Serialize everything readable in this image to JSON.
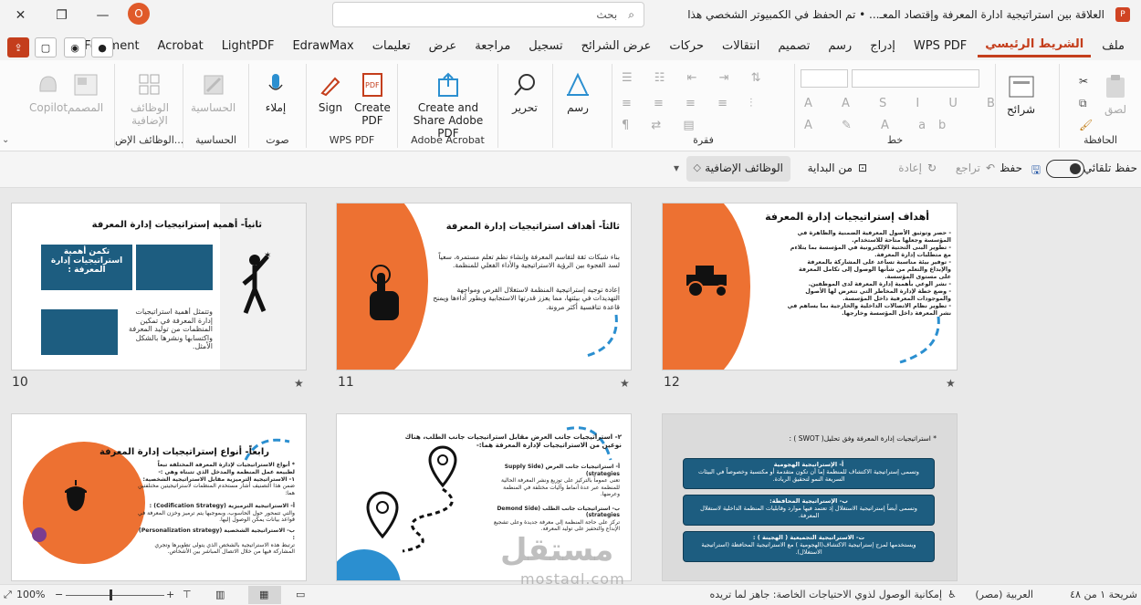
{
  "titlebar": {
    "doc_title": "العلاقة بين استراتيجية ادارة المعرفة وإقتصاد المعـ...  •  تم الحفظ في الكمبيوتر الشخصي هذا",
    "avatar_letter": "O",
    "search_placeholder": "بحث",
    "app_letter": "P"
  },
  "tabs": [
    "ملف",
    "الشريط الرئيسي",
    "WPS PDF",
    "إدراج",
    "رسم",
    "تصميم",
    "انتقالات",
    "حركات",
    "عرض الشرائح",
    "تسجيل",
    "مراجعة",
    "عرض",
    "تعليمات",
    "EdrawMax",
    "LightPDF",
    "Acrobat",
    "PDFelement"
  ],
  "active_tab": "الشريط الرئيسي",
  "ribbon": {
    "clipboard": {
      "label": "الحافظة",
      "paste": "لصق"
    },
    "slides": {
      "label": "شرائح"
    },
    "font": {
      "label": "خط"
    },
    "paragraph": {
      "label": "فقرة"
    },
    "draw": {
      "label": "رسم"
    },
    "edit": {
      "label": "تحرير"
    },
    "acrobat": {
      "label": "Adobe Acrobat",
      "btn": "Create and Share Adobe PDF"
    },
    "wps": {
      "label": "WPS PDF",
      "create": "Create PDF",
      "sign": "Sign"
    },
    "voice": {
      "label": "صوت",
      "dictate": "إملاء"
    },
    "sensitivity": {
      "label": "الحساسية",
      "btn": "الحساسية"
    },
    "addins": {
      "label": "الوظائف الإض...",
      "btn": "الوظائف الإضافية"
    },
    "designer": {
      "btn": "المصمم"
    },
    "copilot": {
      "btn": "Copilot"
    }
  },
  "bar2": {
    "autosave": "حفظ تلقائي",
    "save": "حفظ",
    "undo": "تراجع",
    "redo": "إعادة",
    "from_start": "من البداية",
    "addins": "الوظائف الإضافية"
  },
  "slides": [
    {
      "num": "10",
      "title": "ثانياً- أهمية إستراتيجيات إدارة المعرفة",
      "box_title": "تكمن أهمية استراتيجيات إدارة المعرفة :",
      "box_lower": "وتتمثل أهمية استراتيجيات إدارة المعرفة في تمكين المنظمات من توليد المعرفة واكتسابها ونشرها بالشكل الأمثل."
    },
    {
      "num": "11",
      "title": "ثالثاً- أهداف استراتيجيات إدارة المعرفة",
      "lines": [
        "بناء شبكات ثقة لتقاسم المعرفة وإنشاء نظم تعلم مستمرة، سعياً لسد الفجوة بين الرؤية الاستراتيجية والأداء الفعلي للمنظمة.",
        "إعادة توجيه إستراتيجية المنظمة لاستغلال الفرص ومواجهة التهديدات في بيئتها، مما يعزز قدرتها الاستجابية ويطور أداءها ويمنح قاعدة تنافسية أكثر مرونة."
      ]
    },
    {
      "num": "12",
      "title": "أهداف إستراتيجيات إدارة المعرفة",
      "lines": [
        "- حصر وتوثيق الأصول المعرفية الضمنية والظاهرة في المؤسسة وجعلها متاحة للاستخدام.",
        "- تطوير البنى التحتية الإلكترونية في المؤسسة بما يتلاءم مع متطلبات إدارة المعرفة.",
        "- توفير بيئة مناسبة تساعد على المشاركة بالمعرفة والإبداع والتعلم من شأنها الوصول إلى تكامل المعرفة على مستوى المؤسسة.",
        "- نشر الوعي بأهمية إدارة المعرفة لدى الموظفين.",
        "- وضع خطة لإدارة المخاطر التي تتعرض لها الأصول والموجودات المعرفية داخل المؤسسة.",
        "- تطوير نظام الاتصالات الداخلية والخارجية بما يساهم في نشر المعرفة داخل المؤسسة وخارجها."
      ]
    },
    {
      "num": "",
      "title": "رابعاً- أنواع إستراتيجيات إدارة المعرفة",
      "lines": [
        "* أنواع الاستراتيجيات لإدارة المعرفة المختلفة تبعاً لطبيعة عمل المنظمة والمدخل الذي تتبناه وهي :-",
        "١- الاستراتيجية الترميزية مقابل الاستراتيجية الشخصية:",
        "ضمن هذا التصنيف أشار مستخدم المنظمات لاستراتيجيتين مختلفتين هما:",
        "أ- الاستراتيجية الترميزية (Codification Strategy) :",
        "والتي تتمحور حول الحاسوب، وبموجبها يتم ترميز وخزن المعرفة في قواعد بيانات يمكن الوصول إليها.",
        "ب- الاستراتيجية الشخصية (Personalization strategy) :",
        "ترتبط هذه الاستراتيجية بالشخص الذي يتولى تطويرها وتجري المشاركة فيها من خلال الاتصال المباشر بين الأشخاص."
      ]
    },
    {
      "num": "",
      "title": "٢- استراتيجيات جانب العرض مقابل استراتيجيات جانب الطلب، هناك نوعين من الاستراتيجيات لإدارة المعرفة هما:-",
      "lines": [
        "أ- استراتيجيات جانب العرض (Supply Side strategies)",
        "تعنى عموماً بالتركيز على توزيع ونشر المعرفة الحالية للمنظمة عبر عدة أنماط وآليات مختلفة في المنظمة وعرضها.",
        "ب- استراتيجيات جانب الطلب (Demond Side strategies)",
        "تركز على حاجة المنظمة إلى معرفة جديدة وعلى تشجيع الإبداع والتحفيز على توليد المعرفة."
      ]
    },
    {
      "num": "",
      "title": "* استراتيجيات إدارة المعرفة وفق تحليل( SWOT ) :",
      "boxes": [
        {
          "title": "أ- الإستراتيجية الهجومية",
          "text": "وتسمى إستراتيجية الاكتشاف للمنظمة إما أن تكون متقدمة أو مكتسبة وخصوصاً في البيئات السريعة النمو لتحقيق الريادة."
        },
        {
          "title": "ب- الإستراتيجية المحافظة:",
          "text": "وتسمى أيضاً إستراتيجية الاستغلال إذ تعتمد فيها موارد وقابليات المنظمة الداخلية لاستغلال المعرفة."
        },
        {
          "title": "ت- الاستراتيجية التجميعية ( الهجينة ) :",
          "text": "ويستخدمها لمزج إستراتيجية الاكتشاف(الهجومية ) مع الاستراتيجية المحافظة (استراتيجية الاستغلال)."
        }
      ]
    }
  ],
  "watermark": {
    "text": "mostaql.com",
    "arabic": "مستقل"
  },
  "status": {
    "slide_counter": "شريحة ١ من ٤٨",
    "language": "العربية (مصر)",
    "accessibility": "إمكانية الوصول لذوي الاحتياجات الخاصة: جاهز لما تريده",
    "zoom": "100%"
  },
  "colors": {
    "accent": "#c43e1c",
    "orange": "#ed7132",
    "teal": "#1d5d80",
    "blue": "#2b8fd0"
  }
}
